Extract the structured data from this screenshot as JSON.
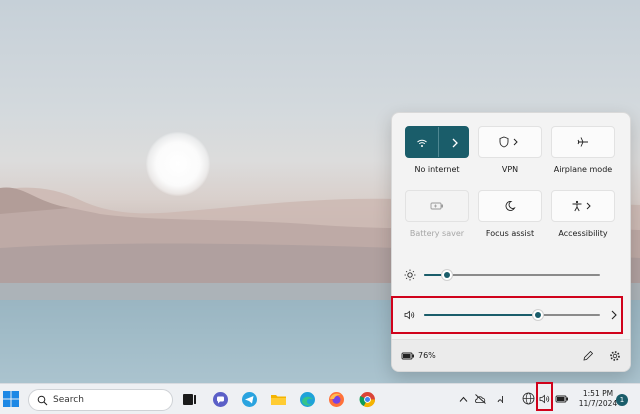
{
  "quick_settings": {
    "tiles": [
      {
        "id": "wifi",
        "label": "No internet",
        "icon": "wifi-icon",
        "active": true
      },
      {
        "id": "vpn",
        "label": "VPN",
        "icon": "shield-icon",
        "active": false
      },
      {
        "id": "airplane",
        "label": "Airplane mode",
        "icon": "airplane-icon",
        "active": false
      },
      {
        "id": "battery_saver",
        "label": "Battery saver",
        "icon": "battery-saver-icon",
        "active": false,
        "disabled": true
      },
      {
        "id": "focus",
        "label": "Focus assist",
        "icon": "moon-icon",
        "active": false
      },
      {
        "id": "accessibility",
        "label": "Accessibility",
        "icon": "accessibility-icon",
        "active": false
      }
    ],
    "brightness_level": 0.13,
    "volume_level": 0.65,
    "battery_percent": "76%"
  },
  "taskbar": {
    "search_placeholder": "Search",
    "time": "1:51 PM",
    "date": "11/7/2024",
    "notification_count": "1"
  },
  "colors": {
    "accent": "#1a5d6a",
    "highlight": "#d0021b"
  }
}
